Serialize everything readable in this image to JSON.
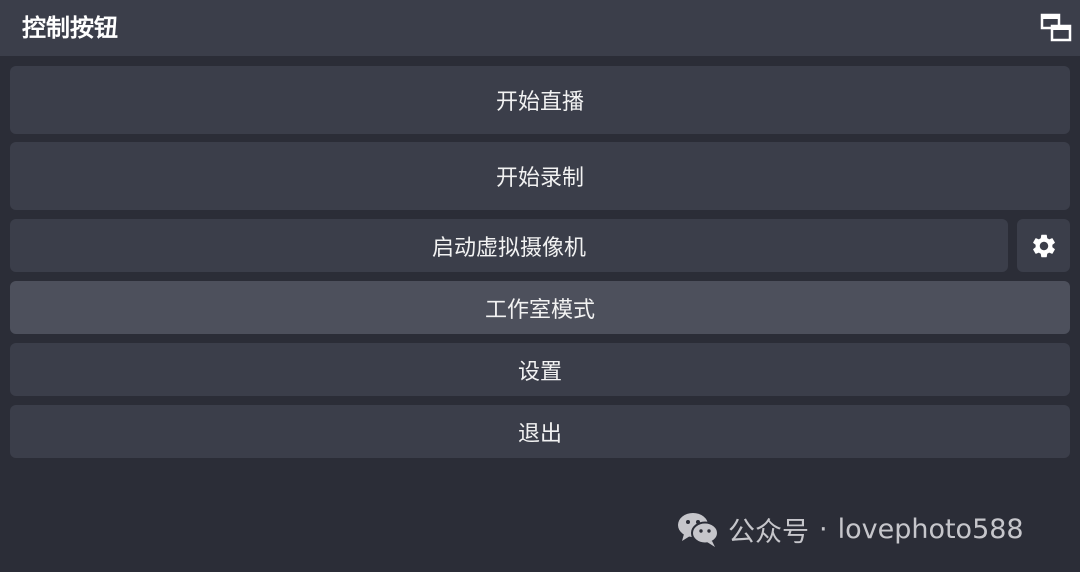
{
  "dock": {
    "title": "控制按钮",
    "undock_icon": "float-window-icon"
  },
  "buttons": {
    "start_streaming": "开始直播",
    "start_recording": "开始录制",
    "start_virtual_camera": "启动虚拟摄像机",
    "virtual_camera_settings_icon": "gear-icon",
    "studio_mode": "工作室模式",
    "settings": "设置",
    "exit": "退出"
  },
  "watermark": {
    "icon": "wechat-icon",
    "label": "公众号",
    "separator": "·",
    "account": "lovephoto588"
  },
  "colors": {
    "background": "#2b2d37",
    "panel": "#3b3e4a",
    "highlight": "#4d505c",
    "text": "#f2f2f2"
  }
}
